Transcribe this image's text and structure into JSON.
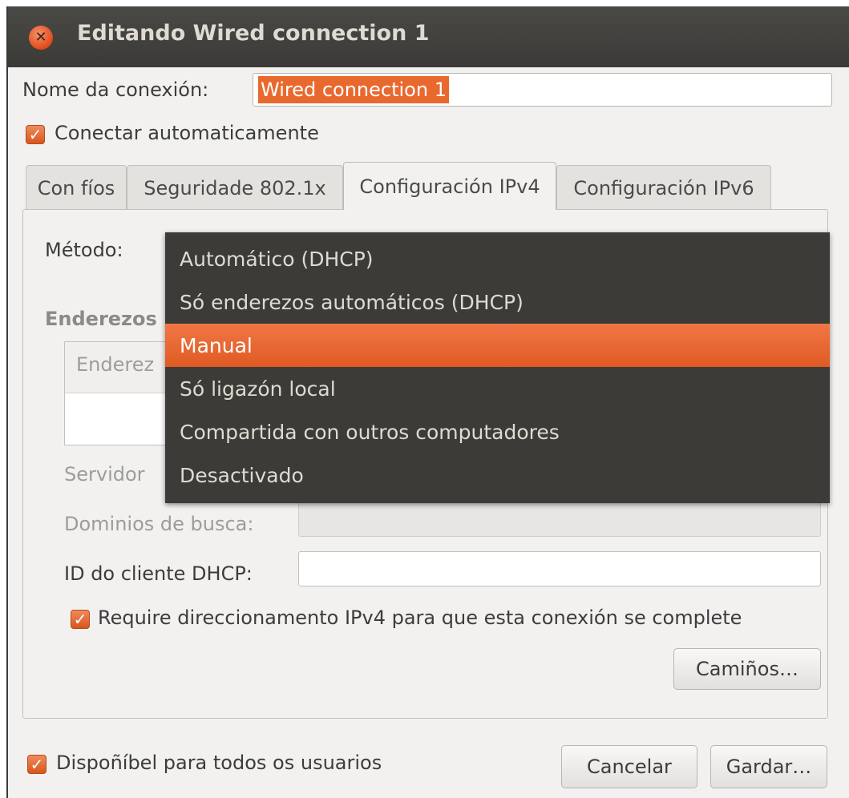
{
  "window": {
    "title": "Editando Wired connection 1",
    "close_icon": "✕"
  },
  "connection_name": {
    "label": "Nome da conexión:",
    "value": "Wired connection 1"
  },
  "auto_connect": {
    "label": "Conectar automaticamente",
    "checked": true
  },
  "tabs": [
    {
      "label": "Con fíos",
      "active": false
    },
    {
      "label": "Seguridade 802.1x",
      "active": false
    },
    {
      "label": "Configuración IPv4",
      "active": true
    },
    {
      "label": "Configuración IPv6",
      "active": false
    }
  ],
  "ipv4": {
    "method_label": "Método:",
    "addresses_label": "Enderezos",
    "addresses_column": "Enderez",
    "dns_label": "Servidor",
    "search_domains_label": "Dominios de busca:",
    "dhcp_client_id_label": "ID do cliente DHCP:",
    "require_ipv4": {
      "label": "Require direccionamento IPv4 para que esta conexión se complete",
      "checked": true
    },
    "routes_button": "Camiños…"
  },
  "method_dropdown": {
    "options": [
      "Automático (DHCP)",
      "Só enderezos automáticos (DHCP)",
      "Manual",
      "Só ligazón local",
      "Compartida con outros computadores",
      "Desactivado"
    ],
    "highlighted": "Manual"
  },
  "footer": {
    "all_users": {
      "label": "Dispoñíbel para todos os usuarios",
      "checked": true
    },
    "cancel_button": "Cancelar",
    "save_button": "Gardar…"
  },
  "colors": {
    "accent": "#e05a22",
    "titlebar": "#3b3a37",
    "menu_bg": "#3c3b37"
  },
  "check_glyph": "✓"
}
